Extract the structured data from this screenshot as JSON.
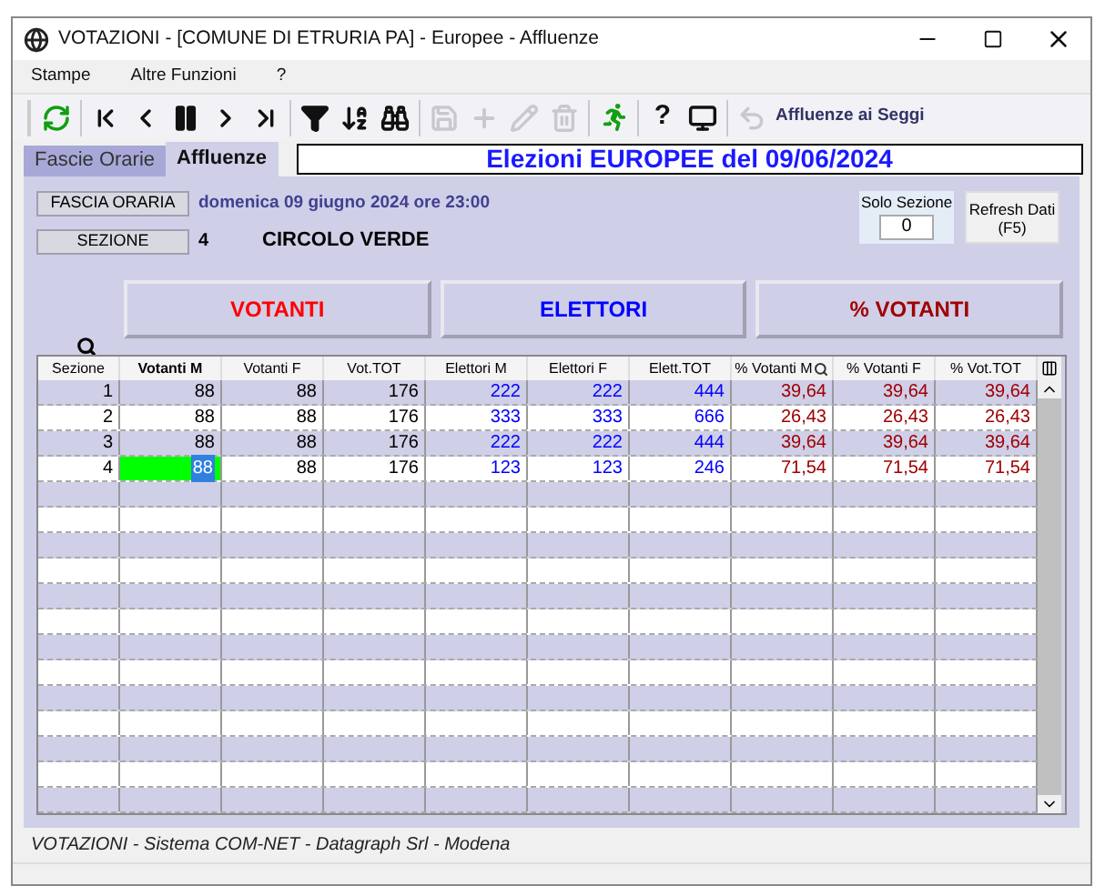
{
  "window": {
    "title": "VOTAZIONI - [COMUNE DI ETRURIA PA] - Europee - Affluenze"
  },
  "menu": [
    "Stampe",
    "Altre Funzioni",
    "?"
  ],
  "toolbar": [
    {
      "kind": "refresh",
      "disabled": false
    },
    {
      "kind": "first",
      "disabled": false
    },
    {
      "kind": "prev",
      "disabled": false
    },
    {
      "kind": "pause",
      "disabled": false
    },
    {
      "kind": "next",
      "disabled": false
    },
    {
      "kind": "last",
      "disabled": false
    },
    {
      "kind": "filter",
      "disabled": false
    },
    {
      "kind": "sort",
      "disabled": false
    },
    {
      "kind": "find",
      "disabled": false
    },
    {
      "kind": "save",
      "disabled": true
    },
    {
      "kind": "add",
      "disabled": true
    },
    {
      "kind": "edit",
      "disabled": true
    },
    {
      "kind": "delete",
      "disabled": true
    },
    {
      "kind": "run",
      "disabled": false
    },
    {
      "kind": "help",
      "label": "?",
      "disabled": false
    },
    {
      "kind": "monitor",
      "disabled": false
    },
    {
      "kind": "undo",
      "disabled": true
    }
  ],
  "toolbar_caption": "Affluenze ai Seggi",
  "tabs": [
    {
      "label": "Fascie Orarie",
      "selected": false
    },
    {
      "label": "Affluenze",
      "selected": true
    }
  ],
  "heading": "Elezioni EUROPEE del 09/06/2024",
  "info": {
    "fascia_label": "FASCIA ORARIA",
    "fascia_value": "domenica 09 giugno 2024 ore 23:00",
    "sezione_label": "SEZIONE",
    "sezione_value": "4",
    "sezione_name": "CIRCOLO VERDE"
  },
  "solo_sezione": {
    "label": "Solo Sezione",
    "value": "0"
  },
  "refresh_button": {
    "line1": "Refresh Dati",
    "line2": "(F5)"
  },
  "groups": [
    {
      "label": "VOTANTI",
      "color": "#ff0000"
    },
    {
      "label": "ELETTORI",
      "color": "#0000ff"
    },
    {
      "label": "% VOTANTI",
      "color": "#a00000"
    }
  ],
  "table": {
    "columns": [
      {
        "label": "Sezione",
        "color": "#000000",
        "selected": false
      },
      {
        "label": "Votanti M",
        "color": "#000000",
        "selected": true
      },
      {
        "label": "Votanti F",
        "color": "#000000",
        "selected": false
      },
      {
        "label": "Vot.TOT",
        "color": "#000000",
        "selected": false
      },
      {
        "label": "Elettori M",
        "color": "#0000ff",
        "selected": false
      },
      {
        "label": "Elettori F",
        "color": "#0000ff",
        "selected": false
      },
      {
        "label": "Elett.TOT",
        "color": "#0000ff",
        "selected": false
      },
      {
        "label": "% Votanti M",
        "color": "#a00000",
        "selected": false,
        "search": true
      },
      {
        "label": "% Votanti F",
        "color": "#a00000",
        "selected": false
      },
      {
        "label": "% Vot.TOT",
        "color": "#a00000",
        "selected": false
      }
    ],
    "rows": [
      {
        "selected": false,
        "cells": [
          "1",
          "88",
          "88",
          "176",
          "222",
          "222",
          "444",
          "39,64",
          "39,64",
          "39,64"
        ]
      },
      {
        "selected": false,
        "cells": [
          "2",
          "88",
          "88",
          "176",
          "333",
          "333",
          "666",
          "26,43",
          "26,43",
          "26,43"
        ]
      },
      {
        "selected": false,
        "cells": [
          "3",
          "88",
          "88",
          "176",
          "222",
          "222",
          "444",
          "39,64",
          "39,64",
          "39,64"
        ]
      },
      {
        "selected": true,
        "cells": [
          "4",
          "88",
          "88",
          "176",
          "123",
          "123",
          "246",
          "71,54",
          "71,54",
          "71,54"
        ]
      }
    ]
  },
  "status_bar": "VOTAZIONI - Sistema COM-NET - Datagraph Srl - Modena"
}
